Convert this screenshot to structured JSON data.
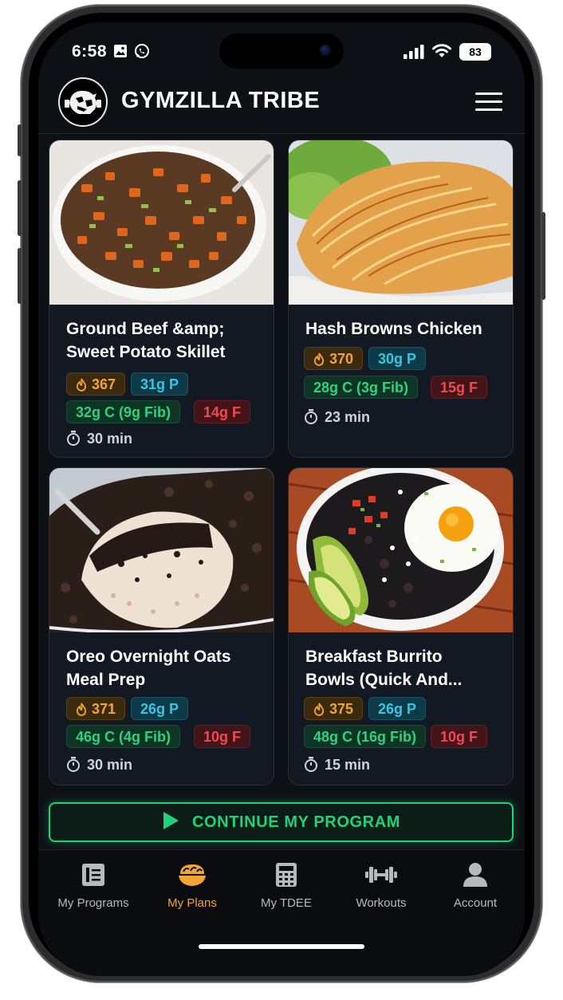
{
  "status_bar": {
    "time": "6:58",
    "battery": "83"
  },
  "header": {
    "title": "GYMZILLA TRIBE"
  },
  "recipes": [
    {
      "title": "Ground Beef &amp;\nSweet Potato Skillet",
      "calories": "367",
      "protein": "31g P",
      "carbs": "32g C (9g Fib)",
      "fat": "14g F",
      "time": "30 min"
    },
    {
      "title": "Hash Browns Chicken",
      "calories": "370",
      "protein": "30g P",
      "carbs": "28g C (3g Fib)",
      "fat": "15g F",
      "time": "23 min"
    },
    {
      "title": "Oreo Overnight Oats\nMeal Prep",
      "calories": "371",
      "protein": "26g P",
      "carbs": "46g C (4g Fib)",
      "fat": "10g F",
      "time": "30 min"
    },
    {
      "title": "Breakfast Burrito\nBowls (Quick And...",
      "calories": "375",
      "protein": "26g P",
      "carbs": "48g C (16g Fib)",
      "fat": "10g F",
      "time": "15 min"
    }
  ],
  "continue_button": {
    "label": "CONTINUE MY PROGRAM"
  },
  "bottom_nav": [
    {
      "label": "My Programs",
      "icon": "programs-icon"
    },
    {
      "label": "My Plans",
      "icon": "bowl-icon",
      "active": true
    },
    {
      "label": "My TDEE",
      "icon": "calculator-icon"
    },
    {
      "label": "Workouts",
      "icon": "dumbbell-icon"
    },
    {
      "label": "Account",
      "icon": "person-icon"
    }
  ],
  "colors": {
    "accent": "#f2a631",
    "green": "#1fd37b",
    "protein": "#35c7e6",
    "fat": "#ef4a52",
    "background": "#0d1014"
  }
}
